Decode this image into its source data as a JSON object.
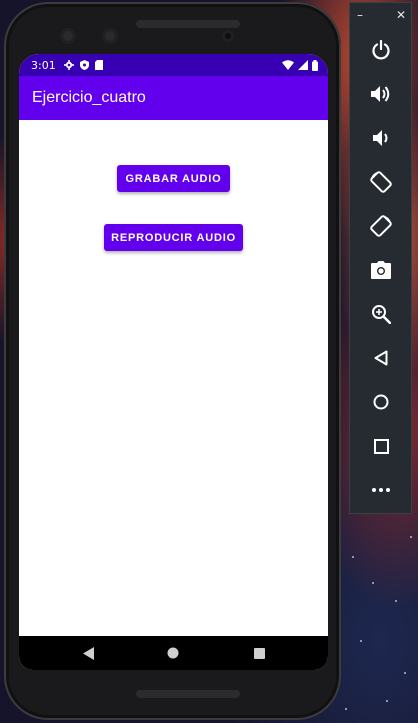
{
  "status_bar": {
    "time": "3:01",
    "left_icons": [
      "settings-icon",
      "shield-icon",
      "sim-card-icon"
    ],
    "right_icons": [
      "wifi-icon",
      "cell-signal-icon",
      "battery-icon"
    ]
  },
  "app_bar": {
    "title": "Ejercicio_cuatro"
  },
  "main": {
    "record_button": "GRABAR AUDIO",
    "play_button": "REPRODUCIR AUDIO"
  },
  "navigation_bar": [
    "back-icon",
    "home-icon",
    "recents-icon"
  ],
  "emulator_toolbar": {
    "window_controls": {
      "minimize": "–",
      "close": "✕"
    },
    "buttons": [
      "power-icon",
      "volume-up-icon",
      "volume-down-icon",
      "rotate-left-icon",
      "rotate-right-icon",
      "camera-icon",
      "zoom-icon",
      "back-icon",
      "home-icon",
      "overview-icon",
      "more-icon"
    ]
  },
  "colors": {
    "primary": "#6200ee",
    "primary_dark": "#3700b3",
    "toolbar_bg": "#262b31"
  }
}
